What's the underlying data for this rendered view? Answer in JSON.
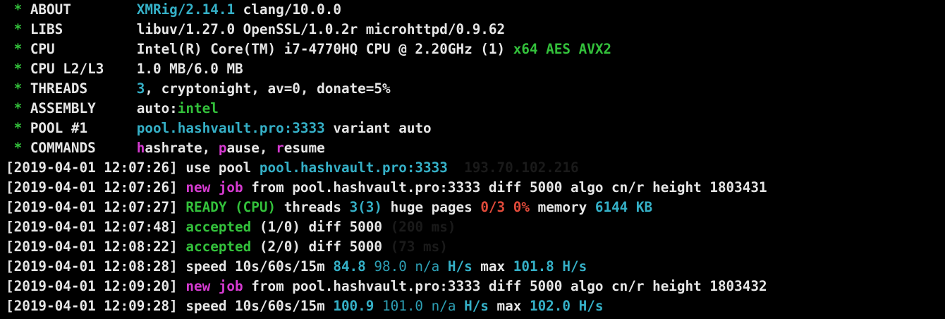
{
  "terminal": {
    "lines": [
      {
        "segments": [
          {
            "text": " * ",
            "color": "green"
          },
          {
            "text": "ABOUT        ",
            "color": "white"
          },
          {
            "text": "XMRig/2.14.1",
            "color": "cyan"
          },
          {
            "text": " clang/10.0.0",
            "color": "white"
          }
        ]
      },
      {
        "segments": [
          {
            "text": " * ",
            "color": "green"
          },
          {
            "text": "LIBS         ",
            "color": "white"
          },
          {
            "text": "libuv/1.27.0 OpenSSL/1.0.2r microhttpd/0.9.62",
            "color": "white"
          }
        ]
      },
      {
        "segments": [
          {
            "text": " * ",
            "color": "green"
          },
          {
            "text": "CPU          ",
            "color": "white"
          },
          {
            "text": "Intel(R) Core(TM) i7-4770HQ CPU @ 2.20GHz (1) ",
            "color": "white"
          },
          {
            "text": "x64 AES AVX2",
            "color": "green"
          }
        ]
      },
      {
        "segments": [
          {
            "text": " * ",
            "color": "green"
          },
          {
            "text": "CPU L2/L3    ",
            "color": "white"
          },
          {
            "text": "1.0 MB/6.0 MB",
            "color": "white"
          }
        ]
      },
      {
        "segments": [
          {
            "text": " * ",
            "color": "green"
          },
          {
            "text": "THREADS      ",
            "color": "white"
          },
          {
            "text": "3",
            "color": "cyan"
          },
          {
            "text": ", cryptonight, av=0, donate=5%",
            "color": "white"
          }
        ]
      },
      {
        "segments": [
          {
            "text": " * ",
            "color": "green"
          },
          {
            "text": "ASSEMBLY     ",
            "color": "white"
          },
          {
            "text": "auto:",
            "color": "white"
          },
          {
            "text": "intel",
            "color": "green"
          }
        ]
      },
      {
        "segments": [
          {
            "text": " * ",
            "color": "green"
          },
          {
            "text": "POOL #1      ",
            "color": "white"
          },
          {
            "text": "pool.hashvault.pro:3333",
            "color": "cyan"
          },
          {
            "text": " variant auto",
            "color": "white"
          }
        ]
      },
      {
        "segments": [
          {
            "text": " * ",
            "color": "green"
          },
          {
            "text": "COMMANDS     ",
            "color": "white"
          },
          {
            "text": "h",
            "color": "magenta"
          },
          {
            "text": "ashrate, ",
            "color": "white"
          },
          {
            "text": "p",
            "color": "magenta"
          },
          {
            "text": "ause, ",
            "color": "white"
          },
          {
            "text": "r",
            "color": "magenta"
          },
          {
            "text": "esume",
            "color": "white"
          }
        ]
      },
      {
        "segments": [
          {
            "text": "[2019-04-01 12:07:26] ",
            "color": "white"
          },
          {
            "text": "use pool ",
            "color": "white"
          },
          {
            "text": "pool.hashvault.pro:3333",
            "color": "cyan"
          },
          {
            "text": "  ",
            "color": "white"
          },
          {
            "text": "193.70.102.216",
            "color": "dark"
          }
        ]
      },
      {
        "segments": [
          {
            "text": "[2019-04-01 12:07:26] ",
            "color": "white"
          },
          {
            "text": "new job",
            "color": "magenta"
          },
          {
            "text": " from pool.hashvault.pro:3333 diff ",
            "color": "white"
          },
          {
            "text": "5000",
            "color": "white"
          },
          {
            "text": " algo cn/r height ",
            "color": "white"
          },
          {
            "text": "1803431",
            "color": "white"
          }
        ]
      },
      {
        "segments": [
          {
            "text": "[2019-04-01 12:07:27] ",
            "color": "white"
          },
          {
            "text": "READY (CPU)",
            "color": "green"
          },
          {
            "text": " threads ",
            "color": "white"
          },
          {
            "text": "3(3)",
            "color": "cyan"
          },
          {
            "text": " huge pages ",
            "color": "white"
          },
          {
            "text": "0/3 0%",
            "color": "red"
          },
          {
            "text": " memory ",
            "color": "white"
          },
          {
            "text": "6144 KB",
            "color": "cyan"
          }
        ]
      },
      {
        "segments": [
          {
            "text": "[2019-04-01 12:07:48] ",
            "color": "white"
          },
          {
            "text": "accepted",
            "color": "green"
          },
          {
            "text": " (1/0) diff ",
            "color": "white"
          },
          {
            "text": "5000",
            "color": "white"
          },
          {
            "text": " ",
            "color": "white"
          },
          {
            "text": "(200 ms)",
            "color": "dark"
          }
        ]
      },
      {
        "segments": [
          {
            "text": "[2019-04-01 12:08:22] ",
            "color": "white"
          },
          {
            "text": "accepted",
            "color": "green"
          },
          {
            "text": " (2/0) diff ",
            "color": "white"
          },
          {
            "text": "5000",
            "color": "white"
          },
          {
            "text": " ",
            "color": "white"
          },
          {
            "text": "(73 ms)",
            "color": "dark"
          }
        ]
      },
      {
        "segments": [
          {
            "text": "[2019-04-01 12:08:28] ",
            "color": "white"
          },
          {
            "text": "speed 10s/60s/15m ",
            "color": "white"
          },
          {
            "text": "84.8",
            "color": "cyan"
          },
          {
            "text": " ",
            "color": "white"
          },
          {
            "text": "98.0 n/a",
            "color": "cyan-dim"
          },
          {
            "text": " ",
            "color": "white"
          },
          {
            "text": "H/s",
            "color": "cyan"
          },
          {
            "text": " max ",
            "color": "white"
          },
          {
            "text": "101.8 H/s",
            "color": "cyan"
          }
        ]
      },
      {
        "segments": [
          {
            "text": "[2019-04-01 12:09:20] ",
            "color": "white"
          },
          {
            "text": "new job",
            "color": "magenta"
          },
          {
            "text": " from pool.hashvault.pro:3333 diff ",
            "color": "white"
          },
          {
            "text": "5000",
            "color": "white"
          },
          {
            "text": " algo cn/r height ",
            "color": "white"
          },
          {
            "text": "1803432",
            "color": "white"
          }
        ]
      },
      {
        "segments": [
          {
            "text": "[2019-04-01 12:09:28] ",
            "color": "white"
          },
          {
            "text": "speed 10s/60s/15m ",
            "color": "white"
          },
          {
            "text": "100.9",
            "color": "cyan"
          },
          {
            "text": " ",
            "color": "white"
          },
          {
            "text": "101.0 n/a",
            "color": "cyan-dim"
          },
          {
            "text": " ",
            "color": "white"
          },
          {
            "text": "H/s",
            "color": "cyan"
          },
          {
            "text": " max ",
            "color": "white"
          },
          {
            "text": "102.0 H/s",
            "color": "cyan"
          }
        ]
      }
    ]
  },
  "colors": {
    "background": "#000000",
    "white": "#e6e6e6",
    "green": "#33c13b",
    "cyan": "#35b0c7",
    "magenta": "#d63bd1",
    "red": "#e04a3a",
    "dark": "#1a1a1a"
  }
}
